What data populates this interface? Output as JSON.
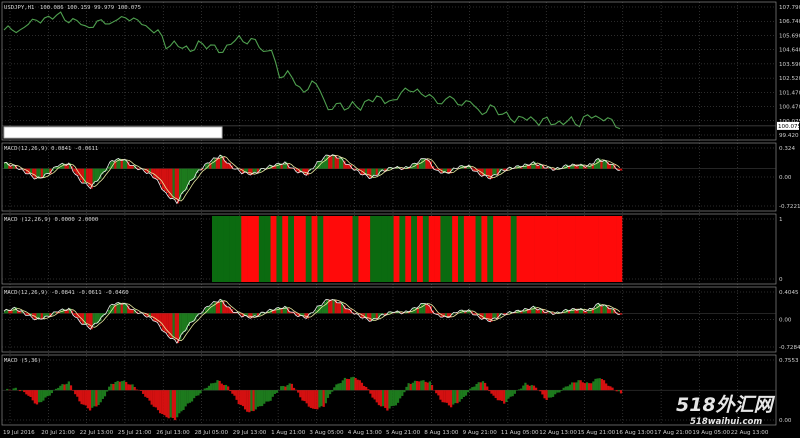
{
  "chart_data": [
    {
      "name": "price",
      "type": "line",
      "title": "USDJPY,H1",
      "ohlc_label": "100.086 100.159 99.979 100.075",
      "y_ticks": [
        "107.790",
        "106.740",
        "105.690",
        "104.640",
        "103.590",
        "102.520",
        "101.470",
        "100.470",
        "100.075",
        "99.420"
      ],
      "ylim": [
        99.42,
        107.79
      ],
      "current_price": "100.075",
      "color": "#4fa04f",
      "series": [
        {
          "values": [
            106.35,
            106.45,
            106.2,
            106.9,
            106.85,
            107.2,
            107.1,
            107.4,
            107.0,
            106.8,
            106.75,
            106.5,
            106.95,
            106.9,
            106.85,
            107.3,
            107.05,
            106.7,
            106.5,
            106.2,
            105.3,
            105.5,
            105.2,
            105.0,
            105.5,
            105.3,
            105.2,
            105.0,
            105.4,
            105.9,
            105.6,
            105.55,
            105.1,
            104.95,
            103.2,
            103.8,
            102.6,
            102.45,
            102.9,
            102.4,
            101.2,
            101.4,
            101.3,
            101.5,
            101.2,
            101.8,
            101.95,
            101.7,
            101.6,
            102.4,
            102.3,
            102.45,
            102.1,
            101.75,
            101.7,
            101.9,
            101.5,
            101.8,
            101.25,
            101.0,
            101.3,
            100.9,
            101.0,
            100.2,
            100.8,
            100.5,
            100.25,
            100.6,
            100.15,
            100.3,
            100.5,
            100.2,
            100.7,
            100.75,
            100.5,
            100.35,
            100.08
          ]
        }
      ]
    },
    {
      "name": "macd1",
      "type": "bar",
      "title": "MACD(12,26,9) 0.0841 -0.0611",
      "y_ticks": [
        "0.324",
        "0.00",
        "-0.7221"
      ],
      "ylim": [
        -0.82,
        0.42
      ],
      "series": [
        {
          "values": [
            0.12,
            0.05,
            -0.08,
            -0.22,
            -0.12,
            0.08,
            0.1,
            -0.25,
            -0.4,
            -0.15,
            0.18,
            0.2,
            0.04,
            -0.05,
            -0.2,
            -0.55,
            -0.72,
            -0.35,
            -0.05,
            0.15,
            0.28,
            0.05,
            -0.08,
            -0.12,
            0.0,
            0.08,
            0.12,
            -0.05,
            -0.12,
            0.12,
            0.3,
            0.24,
            0.05,
            -0.1,
            -0.2,
            -0.05,
            0.03,
            0.0,
            0.1,
            0.24,
            -0.05,
            -0.1,
            0.04,
            0.05,
            -0.12,
            -0.2,
            -0.05,
            0.02,
            0.06,
            0.12,
            0.04,
            -0.02,
            0.06,
            0.08,
            0.05,
            0.2,
            0.12,
            -0.04
          ]
        }
      ]
    },
    {
      "name": "macd2",
      "type": "bar",
      "title": "MACD (12,26,9) 0.0000 2.0000",
      "y_ticks": [
        "1",
        "0"
      ],
      "ylim": [
        0,
        1
      ],
      "start_index": 23,
      "series": [
        {
          "values": [
            0,
            0,
            0,
            0,
            0,
            1,
            1,
            1,
            0,
            0,
            1,
            0,
            1,
            0,
            1,
            1,
            0,
            1,
            0,
            1,
            1,
            1,
            1,
            1,
            0,
            1,
            1,
            0,
            0,
            0,
            0,
            1,
            0,
            1,
            0,
            1,
            0,
            1,
            1,
            0,
            0,
            1,
            0,
            1,
            1,
            0,
            1,
            0,
            1,
            1,
            1,
            0,
            1,
            1,
            1,
            1,
            1,
            1,
            1,
            1,
            1,
            1,
            1,
            1,
            1,
            1,
            1,
            1,
            1,
            1
          ]
        }
      ]
    },
    {
      "name": "macd3",
      "type": "bar",
      "title": "MACD(12,26,9) -0.0841 -0.0611 -0.0460",
      "y_ticks": [
        "0.4045",
        "0.00",
        "-0.7284"
      ],
      "ylim": [
        -0.82,
        0.48
      ],
      "series": [
        {
          "values": [
            0.05,
            0.12,
            -0.02,
            -0.15,
            -0.08,
            0.06,
            0.1,
            -0.2,
            -0.35,
            -0.12,
            0.22,
            0.24,
            0.06,
            -0.04,
            -0.18,
            -0.5,
            -0.68,
            -0.3,
            -0.04,
            0.2,
            0.32,
            0.08,
            -0.06,
            -0.1,
            0.02,
            0.1,
            0.14,
            -0.04,
            -0.1,
            0.14,
            0.34,
            0.26,
            0.06,
            -0.08,
            -0.18,
            -0.04,
            0.04,
            0.01,
            0.12,
            0.26,
            -0.04,
            -0.1,
            0.05,
            0.06,
            -0.1,
            -0.18,
            -0.04,
            0.03,
            0.07,
            0.14,
            0.05,
            -0.01,
            0.07,
            0.1,
            0.06,
            0.22,
            0.14,
            -0.03
          ]
        }
      ]
    },
    {
      "name": "macd4",
      "type": "bar",
      "title": "MACD (5,36)",
      "y_ticks": [
        "0.7553",
        "0.00"
      ],
      "ylim": [
        -0.95,
        0.9
      ],
      "series": [
        {
          "values": [
            0.0,
            0.05,
            -0.1,
            -0.45,
            -0.2,
            0.1,
            0.25,
            -0.35,
            -0.6,
            -0.4,
            0.2,
            0.3,
            0.15,
            -0.1,
            -0.5,
            -0.8,
            -0.9,
            -0.5,
            -0.2,
            0.1,
            0.3,
            0.1,
            -0.4,
            -0.7,
            -0.5,
            -0.3,
            0.1,
            0.2,
            -0.3,
            -0.6,
            -0.5,
            0.1,
            0.35,
            0.4,
            0.1,
            -0.4,
            -0.6,
            -0.4,
            0.2,
            0.3,
            0.25,
            -0.3,
            -0.5,
            -0.3,
            0.1,
            0.3,
            -0.2,
            -0.4,
            -0.1,
            0.2,
            0.1,
            -0.3,
            -0.1,
            0.15,
            0.3,
            0.2,
            0.4,
            0.1,
            -0.1
          ]
        }
      ]
    }
  ],
  "time_axis": {
    "labels": [
      "19 Jul 2016",
      "20 Jul 21:00",
      "22 Jul 13:00",
      "25 Jul 21:00",
      "26 Jul 13:00",
      "28 Jul 05:00",
      "29 Jul 13:00",
      "1 Aug 21:00",
      "3 Aug 05:00",
      "4 Aug 13:00",
      "5 Aug 21:00",
      "8 Aug 13:00",
      "9 Aug 21:00",
      "11 Aug 05:00",
      "12 Aug 13:00",
      "15 Aug 21:00",
      "16 Aug 13:00",
      "17 Aug 21:00",
      "19 Aug 05:00",
      "22 Aug 13:00"
    ]
  },
  "colors": {
    "up": "#1d7a1d",
    "down": "#d41010",
    "signal_up": "#0b6b10",
    "signal_down": "#ff0a0a",
    "macd_line": "#f0f0f0",
    "signal_line": "#e8e8a0",
    "grid": "#5a5a5a",
    "price_line": "#4fa04f"
  },
  "watermark": {
    "line1": "518外汇网",
    "line2": "518waihui.com"
  }
}
